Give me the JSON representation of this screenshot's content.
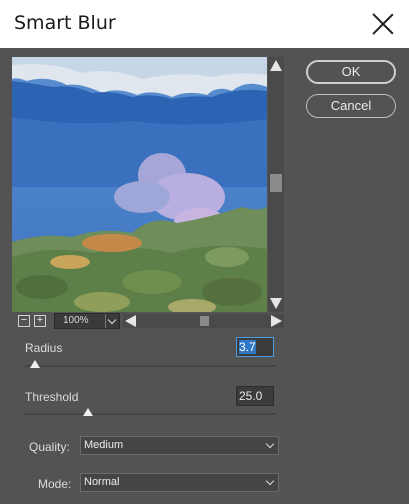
{
  "dialog": {
    "title": "Smart Blur"
  },
  "buttons": {
    "ok_label": "OK",
    "cancel_label": "Cancel"
  },
  "preview": {
    "zoom_out_symbol": "−",
    "zoom_in_symbol": "+",
    "zoom_level": "100%"
  },
  "radius": {
    "label": "Radius",
    "value": "3.7",
    "slider_fraction": 0.04
  },
  "threshold": {
    "label": "Threshold",
    "value": "25.0",
    "slider_fraction": 0.25
  },
  "quality": {
    "label": "Quality:",
    "value": "Medium"
  },
  "mode": {
    "label": "Mode:",
    "value": "Normal"
  },
  "colors": {
    "dialog_bg": "#535353",
    "selection": "#2f77c7"
  }
}
